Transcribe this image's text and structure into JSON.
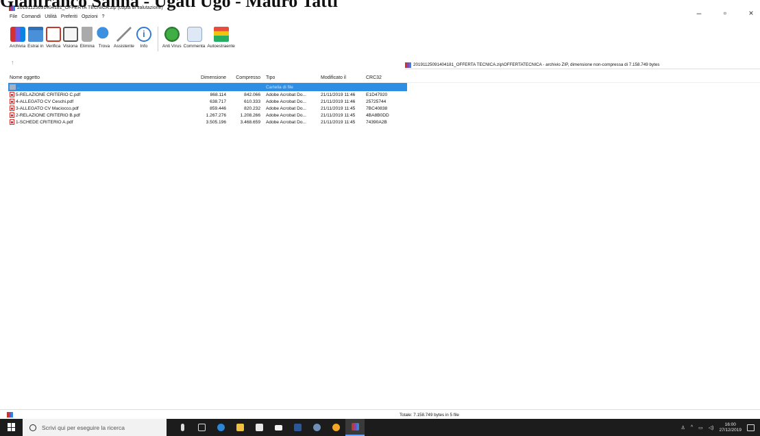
{
  "overlay_header": "Gianfranco Sanna - Ugati Ugo - Mauro Tatti",
  "window": {
    "title": "20191125091404181_OFFERTA TECNICA.zip (copia di valutazione)",
    "minimize": "–",
    "maximize": "▫",
    "close": "×"
  },
  "menu": [
    "File",
    "Comandi",
    "Utilità",
    "Preferiti",
    "Opzioni",
    "?"
  ],
  "toolbar": [
    {
      "label": "Archivia",
      "icon": "archive-icon"
    },
    {
      "label": "Estrai in",
      "icon": "folder-icon"
    },
    {
      "label": "Verifica",
      "icon": "check-icon"
    },
    {
      "label": "Visiona",
      "icon": "book-icon"
    },
    {
      "label": "Elimina",
      "icon": "trash-icon"
    },
    {
      "label": "Trova",
      "icon": "magnifier-icon"
    },
    {
      "label": "Assistente",
      "icon": "wand-icon"
    },
    {
      "label": "Info",
      "icon": "info-icon"
    },
    {
      "label": "Anti Virus",
      "icon": "antivirus-icon"
    },
    {
      "label": "Commenta",
      "icon": "comment-icon"
    },
    {
      "label": "Autoestraente",
      "icon": "sfx-icon"
    }
  ],
  "up_arrow": "↑",
  "path": "20191125091404181_OFFERTA TECNICA.zip\\OFFERTATECNICA - archivio ZIP, dimensione non-compressa di 7.158.749 bytes",
  "columns": [
    "Nome oggetto",
    "Dimensione",
    "Compresso",
    "Tipo",
    "Modificato il",
    "CRC32"
  ],
  "parent_row": {
    "name": "..",
    "type": "Cartella di file"
  },
  "files": [
    {
      "name": "5-RELAZIONE CRITERIO C.pdf",
      "size": "868.114",
      "compressed": "842.066",
      "type": "Adobe Acrobat Do...",
      "modified": "21/11/2019 11:46",
      "crc": "E1D47920"
    },
    {
      "name": "4-ALLEGATO CV Ceschi.pdf",
      "size": "638.717",
      "compressed": "610.333",
      "type": "Adobe Acrobat Do...",
      "modified": "21/11/2019 11:46",
      "crc": "25725744"
    },
    {
      "name": "3-ALLEGATO CV Maciocco.pdf",
      "size": "859.446",
      "compressed": "820.232",
      "type": "Adobe Acrobat Do...",
      "modified": "21/11/2019 11:45",
      "crc": "7BC40838"
    },
    {
      "name": "2-RELAZIONE CRITERIO B.pdf",
      "size": "1.267.276",
      "compressed": "1.208.266",
      "type": "Adobe Acrobat Do...",
      "modified": "21/11/2019 11:45",
      "crc": "4BA8B0DD"
    },
    {
      "name": "1-SCHEDE CRITERIO A.pdf",
      "size": "3.505.196",
      "compressed": "3.468.659",
      "type": "Adobe Acrobat Do...",
      "modified": "21/11/2019 11:45",
      "crc": "74390A2B"
    }
  ],
  "status": "Totale: 7.158.749 bytes in 5 file",
  "taskbar": {
    "search_placeholder": "Scrivi qui per eseguire la ricerca",
    "time": "16:00",
    "date": "27/12/2019"
  },
  "colors": {
    "selection": "#2d8ee3",
    "taskbar": "#1c1c1c"
  }
}
